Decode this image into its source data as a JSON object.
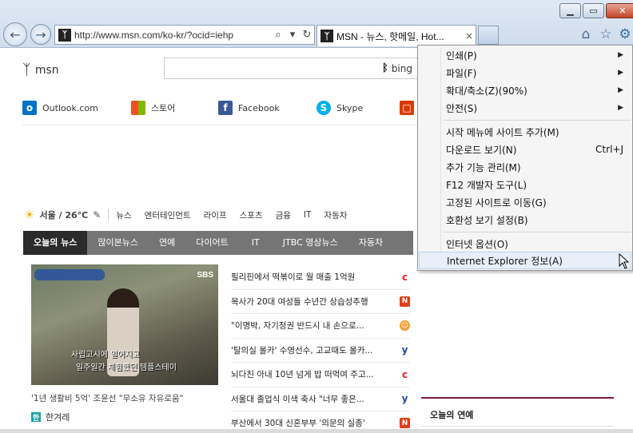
{
  "browser": {
    "address_url": "http://www.msn.com/ko-kr/?ocid=iehp",
    "tab_title": "MSN - 뉴스, 핫메일, Hot...",
    "tab_close": "×",
    "minimize": "▁",
    "maximize": "▭",
    "close": "✕"
  },
  "header": {
    "logo_text": "msn",
    "search_engine": "bing",
    "search_value": ""
  },
  "quick_links": [
    {
      "label": "Outlook.com",
      "icon": "outlook-icon",
      "color": "#0072c6"
    },
    {
      "label": "스토어",
      "icon": "store-icon",
      "color": "#f25022"
    },
    {
      "label": "Facebook",
      "icon": "facebook-icon",
      "color": "#3b5998"
    },
    {
      "label": "Skype",
      "icon": "skype-icon",
      "color": "#00aff0"
    },
    {
      "label": "",
      "icon": "office-icon",
      "color": "#d83b01"
    }
  ],
  "weather": {
    "location": "서울 / 26°C",
    "categories": [
      "뉴스",
      "엔터테인먼트",
      "라이프",
      "스포츠",
      "금융",
      "IT",
      "자동차"
    ]
  },
  "news_tabs": [
    "오늘의 뉴스",
    "많이본뉴스",
    "연예",
    "다이어트",
    "IT",
    "JTBC 영상뉴스",
    "자동차"
  ],
  "hero": {
    "network": "SBS",
    "caption_line1": "사립고시에 일어지고",
    "caption_line2": "일주일간 체험했던 템플스테이",
    "headline": "'1년 생활비 5억' 조윤선 \"무소유 자유로움\"",
    "source": "한겨레"
  },
  "headlines": [
    {
      "text": "필리핀에서 떡볶이로 월 매출 1억원",
      "source_color": "#e22"
    },
    {
      "text": "목사가 20대 여성들 수년간 상습성추행",
      "source_color": "#e33c1c"
    },
    {
      "text": "\"이명박, 자기정권 반드시 내 손으로...",
      "source_color": "#f0a030"
    },
    {
      "text": "'탈의실 몰카' 수영선수, 고교때도 몰카...",
      "source_color": "#1b4fa0"
    },
    {
      "text": "뇌다친 아내 10년 넘게 밥 떠먹여 주고...",
      "source_color": "#e22"
    },
    {
      "text": "서울대 졸업식 이색 축사 \"너무 좋은...",
      "source_color": "#1b4fa0"
    },
    {
      "text": "부산에서 30대 신혼부부 '의문의 실종'",
      "source_color": "#e33c1c"
    }
  ],
  "side_section": {
    "title": "오늘의 연예"
  },
  "menu": {
    "group1": [
      {
        "label": "인쇄(P)",
        "submenu": true
      },
      {
        "label": "파일(F)",
        "submenu": true
      },
      {
        "label": "확대/축소(Z)(90%)",
        "submenu": true
      },
      {
        "label": "안전(S)",
        "submenu": true
      }
    ],
    "group2": [
      {
        "label": "시작 메뉴에 사이트 추가(M)",
        "shortcut": ""
      },
      {
        "label": "다운로드 보기(N)",
        "shortcut": "Ctrl+J"
      },
      {
        "label": "추가 기능 관리(M)",
        "shortcut": ""
      },
      {
        "label": "F12 개발자 도구(L)",
        "shortcut": ""
      },
      {
        "label": "고정된 사이트로 이동(G)",
        "shortcut": ""
      },
      {
        "label": "호환성 보기 설정(B)",
        "shortcut": ""
      }
    ],
    "group3": [
      {
        "label": "인터넷 옵션(O)"
      },
      {
        "label": "Internet Explorer 정보(A)"
      }
    ],
    "submenu_arrow": "▶"
  }
}
